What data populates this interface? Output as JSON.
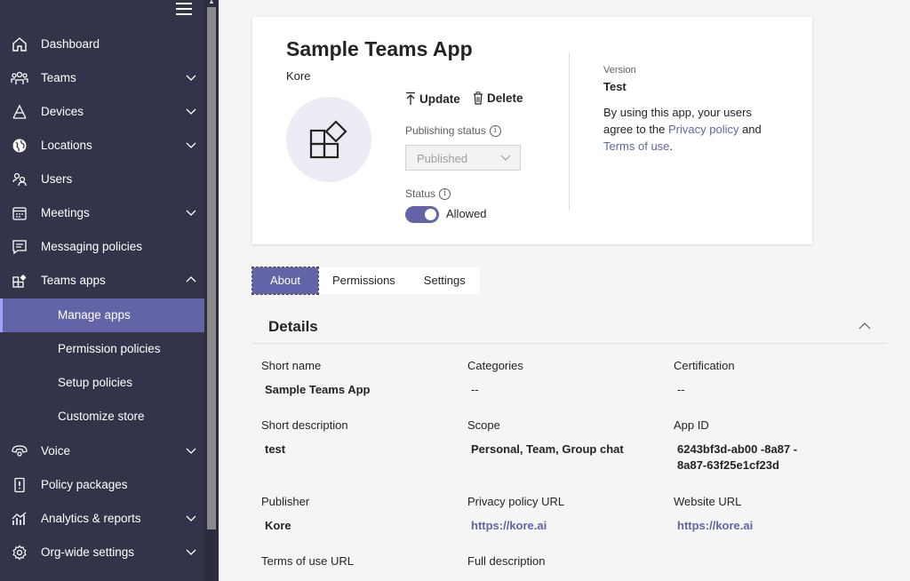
{
  "sidebar": {
    "items": [
      {
        "label": "Dashboard",
        "icon": "home-icon",
        "chevron": false
      },
      {
        "label": "Teams",
        "icon": "teams-icon",
        "chevron": true
      },
      {
        "label": "Devices",
        "icon": "devices-icon",
        "chevron": true
      },
      {
        "label": "Locations",
        "icon": "globe-icon",
        "chevron": true
      },
      {
        "label": "Users",
        "icon": "users-icon",
        "chevron": false
      },
      {
        "label": "Meetings",
        "icon": "calendar-icon",
        "chevron": true
      },
      {
        "label": "Messaging policies",
        "icon": "message-icon",
        "chevron": false
      },
      {
        "label": "Teams apps",
        "icon": "apps-icon",
        "chevron": true
      },
      {
        "label": "Voice",
        "icon": "voice-icon",
        "chevron": true
      },
      {
        "label": "Policy packages",
        "icon": "policy-package-icon",
        "chevron": false
      },
      {
        "label": "Analytics & reports",
        "icon": "analytics-icon",
        "chevron": true
      },
      {
        "label": "Org-wide settings",
        "icon": "settings-icon",
        "chevron": true
      }
    ],
    "subitems": [
      {
        "label": "Manage apps",
        "active": true
      },
      {
        "label": "Permission policies",
        "active": false
      },
      {
        "label": "Setup policies",
        "active": false
      },
      {
        "label": "Customize store",
        "active": false
      }
    ]
  },
  "app": {
    "title": "Sample Teams App",
    "publisher": "Kore",
    "update_label": "Update",
    "delete_label": "Delete",
    "publishing_status_label": "Publishing status",
    "publishing_status_value": "Published",
    "status_label": "Status",
    "status_value": "Allowed",
    "status_on": true,
    "version_label": "Version",
    "version_value": "Test",
    "terms_text_1": "By using this app, your users agree to the ",
    "privacy_link": "Privacy policy",
    "terms_text_2": " and ",
    "terms_link": "Terms of use",
    "terms_text_3": "."
  },
  "tabs": [
    "About",
    "Permissions",
    "Settings"
  ],
  "details": {
    "title": "Details",
    "short_name_label": "Short name",
    "short_name": "Sample Teams App",
    "categories_label": "Categories",
    "categories": "--",
    "certification_label": "Certification",
    "certification": "--",
    "short_description_label": "Short description",
    "short_description": "test",
    "scope_label": "Scope",
    "scope": "Personal, Team, Group chat",
    "app_id_label": "App ID",
    "app_id": "6243bf3d-ab00 -8a87 - 8a87-63f25e1cf23d",
    "publisher_label": "Publisher",
    "publisher": "Kore",
    "privacy_url_label": "Privacy policy URL",
    "privacy_url": "https://kore.ai",
    "website_url_label": "Website URL",
    "website_url": "https://kore.ai",
    "terms_url_label": "Terms of use URL",
    "full_description_label": "Full description"
  },
  "colors": {
    "sidebar_bg": "#33344a",
    "accent": "#6264a7",
    "page_bg": "#f5f5f5"
  }
}
